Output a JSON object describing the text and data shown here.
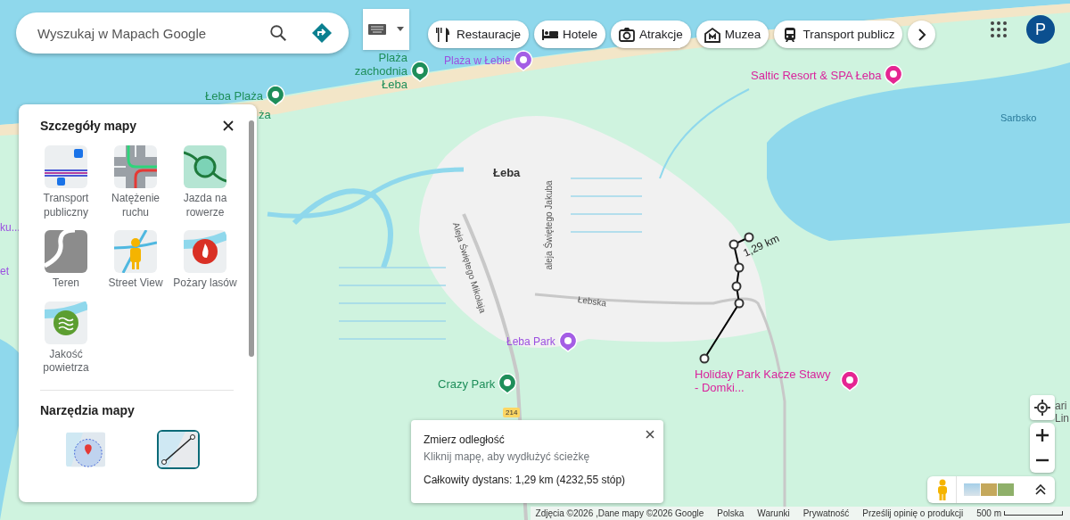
{
  "search": {
    "placeholder": "Wyszukaj w Mapach Google"
  },
  "chips": [
    {
      "label": "Restauracje",
      "kind": "restaurant"
    },
    {
      "label": "Hotele",
      "kind": "hotel"
    },
    {
      "label": "Atrakcje",
      "kind": "camera"
    },
    {
      "label": "Muzea",
      "kind": "museum"
    },
    {
      "label": "Transport publicz",
      "kind": "transit"
    }
  ],
  "account": {
    "initial": "P"
  },
  "map_labels": [
    {
      "text": "Plaża zachodnia Łeba",
      "kind": "poi-green"
    },
    {
      "text": "Plaża w Łebie",
      "kind": "poi-purple"
    },
    {
      "text": "Łeba Plaża",
      "kind": "poi-green"
    },
    {
      "text": "ża",
      "kind": "poi-green-text"
    },
    {
      "text": "Saltic Resort & SPA Łeba",
      "kind": "poi-pink"
    },
    {
      "text": "Sarbsko",
      "kind": "water"
    },
    {
      "text": "Łeba",
      "kind": "town"
    },
    {
      "text": "ku...",
      "kind": "poi-purple-text"
    },
    {
      "text": "et",
      "kind": "poi-purple-text"
    },
    {
      "text": "Aleja Świętego Mikołaja",
      "kind": "road"
    },
    {
      "text": "aleja Świętego Jakuba",
      "kind": "road"
    },
    {
      "text": "Łebska",
      "kind": "road"
    },
    {
      "text": "Łeba Park",
      "kind": "poi-purple"
    },
    {
      "text": "Crazy Park",
      "kind": "poi-green"
    },
    {
      "text": "214",
      "kind": "shield"
    },
    {
      "text": "Holiday Park Kacze Stawy -  Domki...",
      "kind": "poi-pink"
    },
    {
      "text": "1,29 km",
      "kind": "measure"
    },
    {
      "text": "ari",
      "kind": "edge"
    },
    {
      "text": "Lin",
      "kind": "edge"
    }
  ],
  "panel": {
    "title": "Szczegóły mapy",
    "layers": [
      {
        "label": "Transport publiczny",
        "kind": "transit"
      },
      {
        "label": "Natężenie ruchu",
        "kind": "traffic"
      },
      {
        "label": "Jazda na rowerze",
        "kind": "bike"
      },
      {
        "label": "Teren",
        "kind": "terrain"
      },
      {
        "label": "Street View",
        "kind": "streetview"
      },
      {
        "label": "Pożary lasów",
        "kind": "fire"
      },
      {
        "label": "Jakość powietrza",
        "kind": "air"
      }
    ],
    "tools_title": "Narzędzia mapy",
    "tools": [
      {
        "kind": "area",
        "selected": false
      },
      {
        "kind": "distance",
        "selected": true
      }
    ]
  },
  "measure": {
    "title": "Zmierz odległość",
    "hint": "Kliknij mapę, aby wydłużyć ścieżkę",
    "total": "Całkowity dystans: 1,29 km (4232,55 stóp)"
  },
  "footer": {
    "items": [
      "Zdjęcia ©2026 ,Dane mapy ©2026 Google",
      "Polska",
      "Warunki",
      "Prywatność",
      "Prześlij opinię o produkcji"
    ],
    "scale": "500 m"
  }
}
